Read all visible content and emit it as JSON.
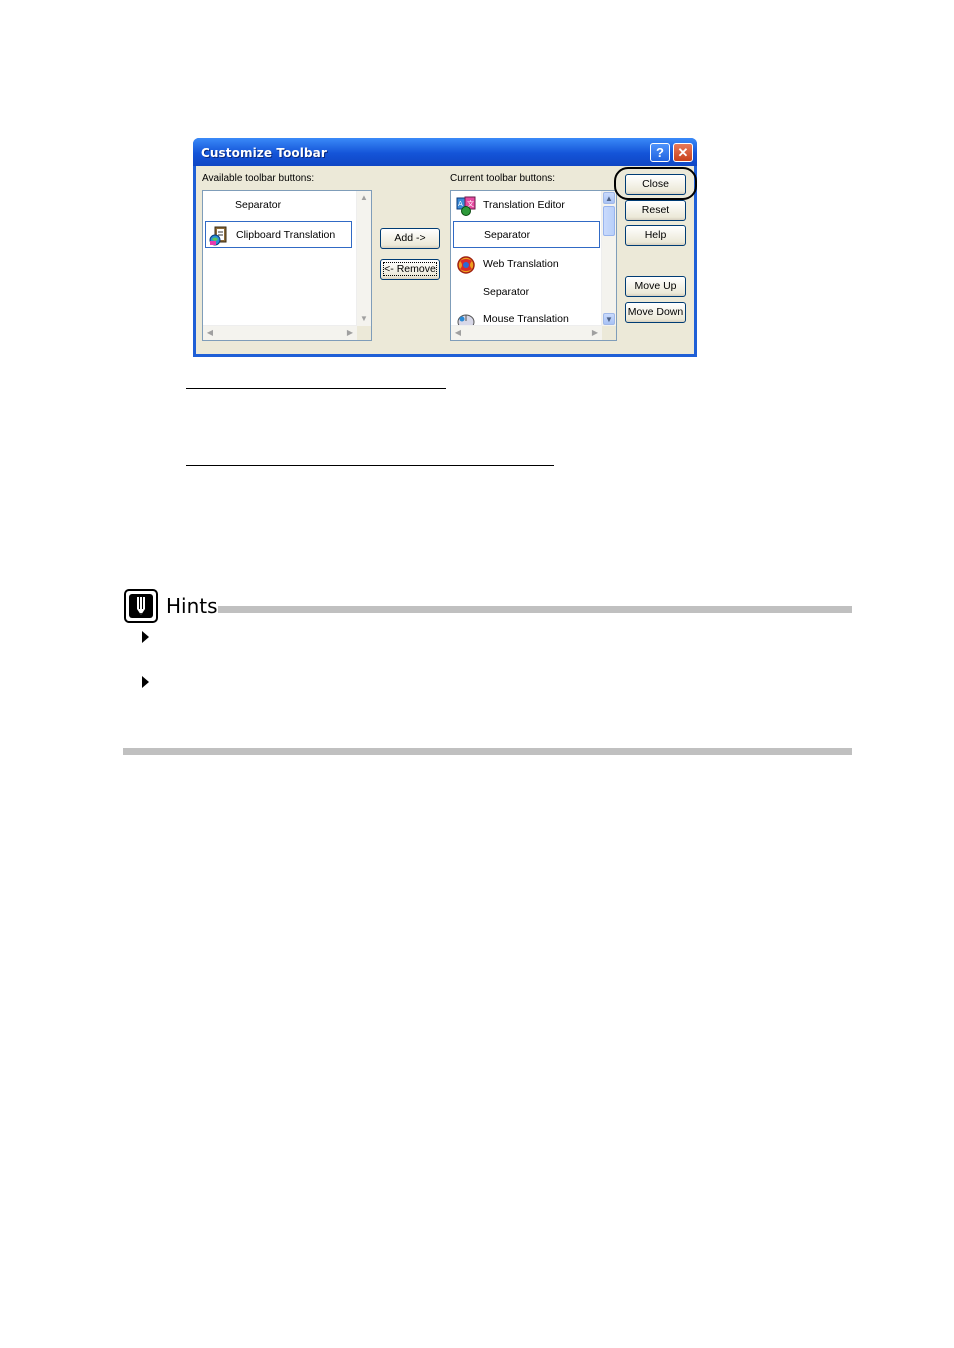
{
  "dialog": {
    "title": "Customize Toolbar",
    "help_glyph": "?",
    "close_glyph": "✕",
    "available_label": "Available toolbar buttons:",
    "current_label": "Current toolbar buttons:",
    "available_items": [
      {
        "label": "Separator",
        "icon": ""
      },
      {
        "label": "Clipboard Translation",
        "icon": "clipboard-translation-icon"
      }
    ],
    "current_items": [
      {
        "label": "Translation Editor",
        "icon": "translation-editor-icon"
      },
      {
        "label": "Separator",
        "icon": ""
      },
      {
        "label": "Web Translation",
        "icon": "web-translation-icon"
      },
      {
        "label": "Separator",
        "icon": ""
      },
      {
        "label": "Mouse Translation",
        "icon": "mouse-translation-icon"
      }
    ],
    "buttons": {
      "add": "Add ->",
      "remove": "<- Remove",
      "close": "Close",
      "reset": "Reset",
      "help": "Help",
      "move_up": "Move Up",
      "move_down": "Move Down"
    }
  },
  "hints": {
    "title": "Hints"
  },
  "colors": {
    "titlebar": "#1454d8",
    "dialog_face": "#ece9d8",
    "selection_border": "#316ac5",
    "rule": "#c0c0c0"
  }
}
